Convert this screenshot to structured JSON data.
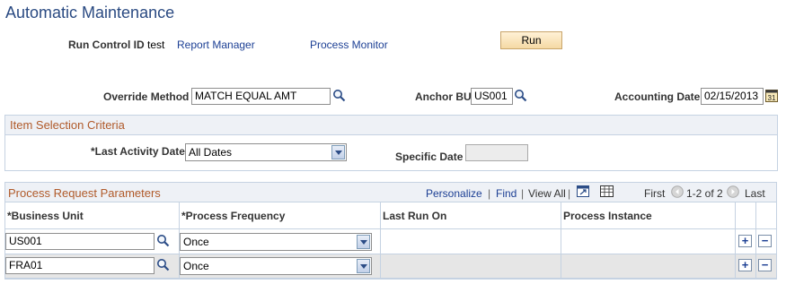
{
  "page": {
    "title": "Automatic Maintenance"
  },
  "header": {
    "run_control_label": "Run Control ID",
    "run_control_value": "test",
    "report_manager": "Report Manager",
    "process_monitor": "Process Monitor",
    "run_button": "Run"
  },
  "fields": {
    "override_method_label": "Override Method",
    "override_method_value": "MATCH EQUAL AMT",
    "anchor_bu_label": "Anchor BU",
    "anchor_bu_value": "US001",
    "accounting_date_label": "Accounting Date",
    "accounting_date_value": "02/15/2013"
  },
  "item_selection": {
    "title": "Item Selection Criteria",
    "last_activity_label": "*Last Activity Date",
    "last_activity_value": "All Dates",
    "specific_date_label": "Specific Date",
    "specific_date_value": ""
  },
  "process_grid": {
    "title": "Process Request Parameters",
    "nav": {
      "personalize": "Personalize",
      "find": "Find",
      "view_all": "View All",
      "first": "First",
      "range": "1-2 of 2",
      "last": "Last",
      "sep1": "|",
      "sep2": "|",
      "sep3": "|"
    },
    "columns": [
      "*Business Unit",
      "*Process Frequency",
      "Last Run On",
      "Process Instance"
    ],
    "rows": [
      {
        "business_unit": "US001",
        "frequency": "Once",
        "last_run_on": "",
        "process_instance": ""
      },
      {
        "business_unit": "FRA01",
        "frequency": "Once",
        "last_run_on": "",
        "process_instance": ""
      }
    ],
    "add_symbol": "+",
    "delete_symbol": "−"
  },
  "colors": {
    "title": "#2a4a82",
    "link": "#1c3f94",
    "group_header_text": "#b05a2a",
    "alt_row": "#e6e6e6"
  }
}
